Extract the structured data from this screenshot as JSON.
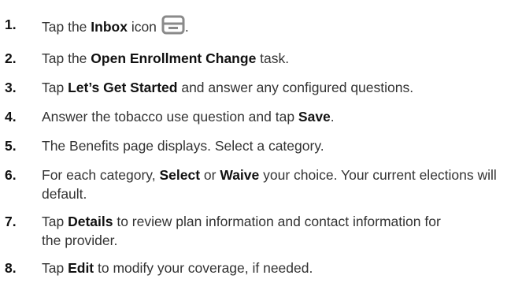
{
  "steps": [
    {
      "number": "1.",
      "parts": [
        {
          "t": "Tap the ",
          "b": false
        },
        {
          "t": "Inbox",
          "b": true
        },
        {
          "t": " icon",
          "b": false
        }
      ],
      "after_icon": ".",
      "icon": "inbox-icon"
    },
    {
      "number": "2.",
      "parts": [
        {
          "t": "Tap the ",
          "b": false
        },
        {
          "t": "Open Enrollment Change",
          "b": true
        },
        {
          "t": " task.",
          "b": false
        }
      ]
    },
    {
      "number": "3.",
      "parts": [
        {
          "t": "Tap ",
          "b": false
        },
        {
          "t": "Let’s Get Started",
          "b": true
        },
        {
          "t": " and answer any configured questions.",
          "b": false
        }
      ]
    },
    {
      "number": "4.",
      "parts": [
        {
          "t": "Answer the tobacco use question and tap ",
          "b": false
        },
        {
          "t": "Save",
          "b": true
        },
        {
          "t": ".",
          "b": false
        }
      ]
    },
    {
      "number": "5.",
      "parts": [
        {
          "t": "The Benefits page displays. Select a category.",
          "b": false
        }
      ]
    },
    {
      "number": "6.",
      "parts": [
        {
          "t": "For each category, ",
          "b": false
        },
        {
          "t": "Select",
          "b": true
        },
        {
          "t": " or ",
          "b": false
        },
        {
          "t": "Waive",
          "b": true
        },
        {
          "t": " your choice. Your current elections will default.",
          "b": false
        }
      ]
    },
    {
      "number": "7.",
      "parts": [
        {
          "t": "Tap ",
          "b": false
        },
        {
          "t": "Details",
          "b": true
        },
        {
          "t": " to review plan information and contact information for the provider.",
          "b": false
        }
      ]
    },
    {
      "number": "8.",
      "parts": [
        {
          "t": "Tap ",
          "b": false
        },
        {
          "t": "Edit",
          "b": true
        },
        {
          "t": " to modify your coverage, if needed.",
          "b": false
        }
      ]
    }
  ],
  "colors": {
    "text": "#333333",
    "bold": "#111111",
    "icon": "#8a8a8a"
  }
}
